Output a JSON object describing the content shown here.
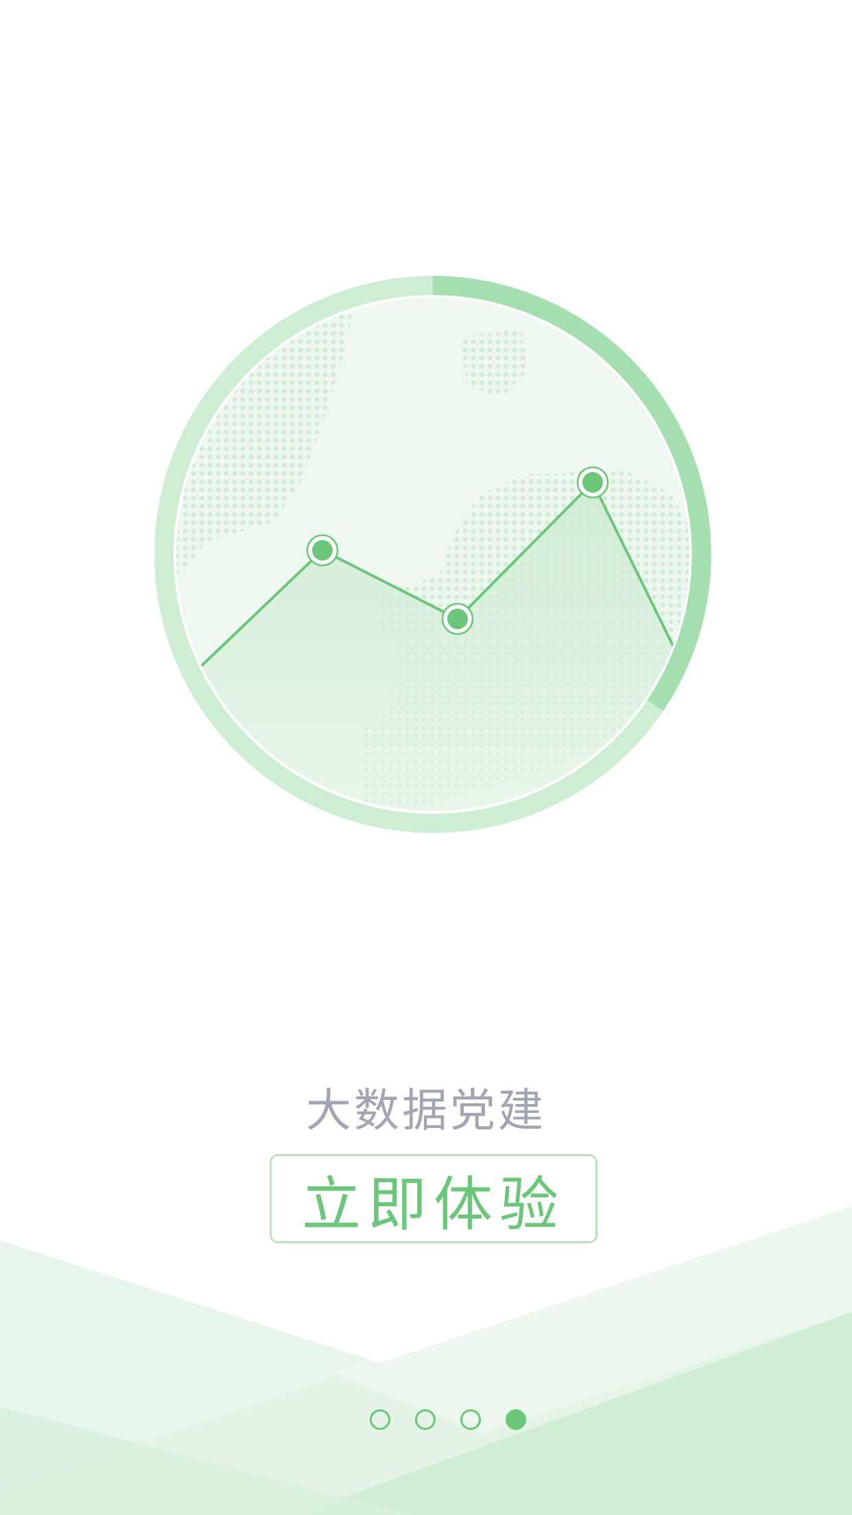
{
  "app": {
    "subtitle": "大数据党建",
    "cta_label": "立即体验"
  },
  "pager": {
    "total": 4,
    "active_index": 3
  },
  "illustration": {
    "icon": "trend-globe-illustration",
    "accent_color": "#6cc67a",
    "light_color": "#dff2e2"
  }
}
